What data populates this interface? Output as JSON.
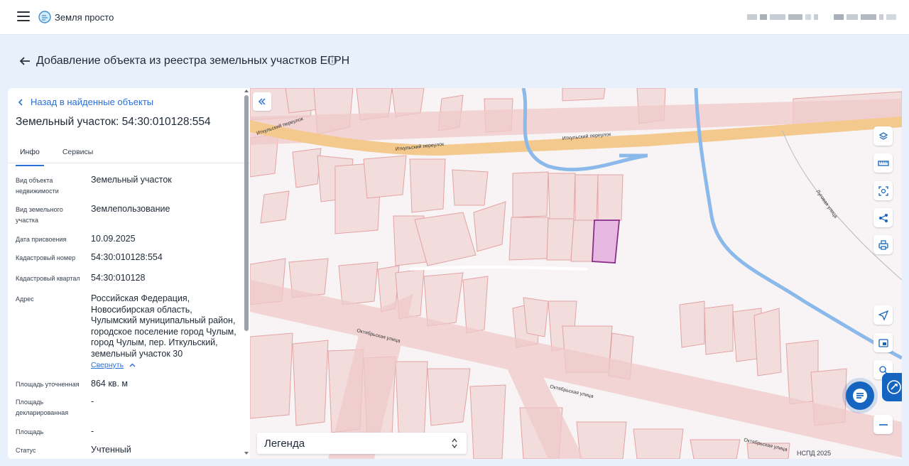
{
  "app": {
    "title": "Земля просто"
  },
  "page": {
    "title": "Добавление объекта из реестра земельных участков ЕГРН"
  },
  "panel": {
    "back_link": "Назад в найденные объекты",
    "title": "Земельный участок: 54:30:010128:554",
    "tabs": [
      {
        "label": "Инфо",
        "active": true
      },
      {
        "label": "Сервисы",
        "active": false
      }
    ],
    "rows": [
      {
        "label": "Вид объекта недвижимости",
        "value": "Земельный участок"
      },
      {
        "label": "Вид земельного участка",
        "value": "Землепользование"
      },
      {
        "label": "Дата присвоения",
        "value": "10.09.2025"
      },
      {
        "label": "Кадастровый номер",
        "value": "54:30:010128:554"
      },
      {
        "label": "Кадастровый квартал",
        "value": "54:30:010128"
      },
      {
        "label": "Адрес",
        "value": "Российская Федерация, Новосибирская область, Чулымский муниципальный район, городское поселение город Чулым, город Чулым, пер. Иткульский, земельный участок 30"
      },
      {
        "label": "Площадь уточненная",
        "value": "864 кв. м"
      },
      {
        "label": "Площадь декларированная",
        "value": "-"
      },
      {
        "label": "Площадь",
        "value": "-"
      },
      {
        "label": "Статус",
        "value": "Учтенный"
      }
    ],
    "collapse_link": "Свернуть"
  },
  "map": {
    "legend": "Легенда",
    "attribution": "НСПД 2025",
    "streets": [
      "Иткульский переулок",
      "Иткульский переулок",
      "Октябрьская улица",
      "Октябрьская улица",
      "Октябрьская улица",
      "Луговая улица"
    ],
    "tools": [
      "layers-icon",
      "ruler-icon",
      "select-area-icon",
      "share-icon",
      "print-icon",
      "locate-icon",
      "basemap-icon",
      "search-location-icon",
      "zoom-out-icon"
    ],
    "colors": {
      "parcel": "#f2dada",
      "parcel_stroke": "#e4a5a5",
      "road": "#f6cf9a",
      "river": "#8cbcec",
      "selected": "#e6b8e2",
      "selected_stroke": "#8b2d8b",
      "accent": "#1565c0"
    }
  }
}
